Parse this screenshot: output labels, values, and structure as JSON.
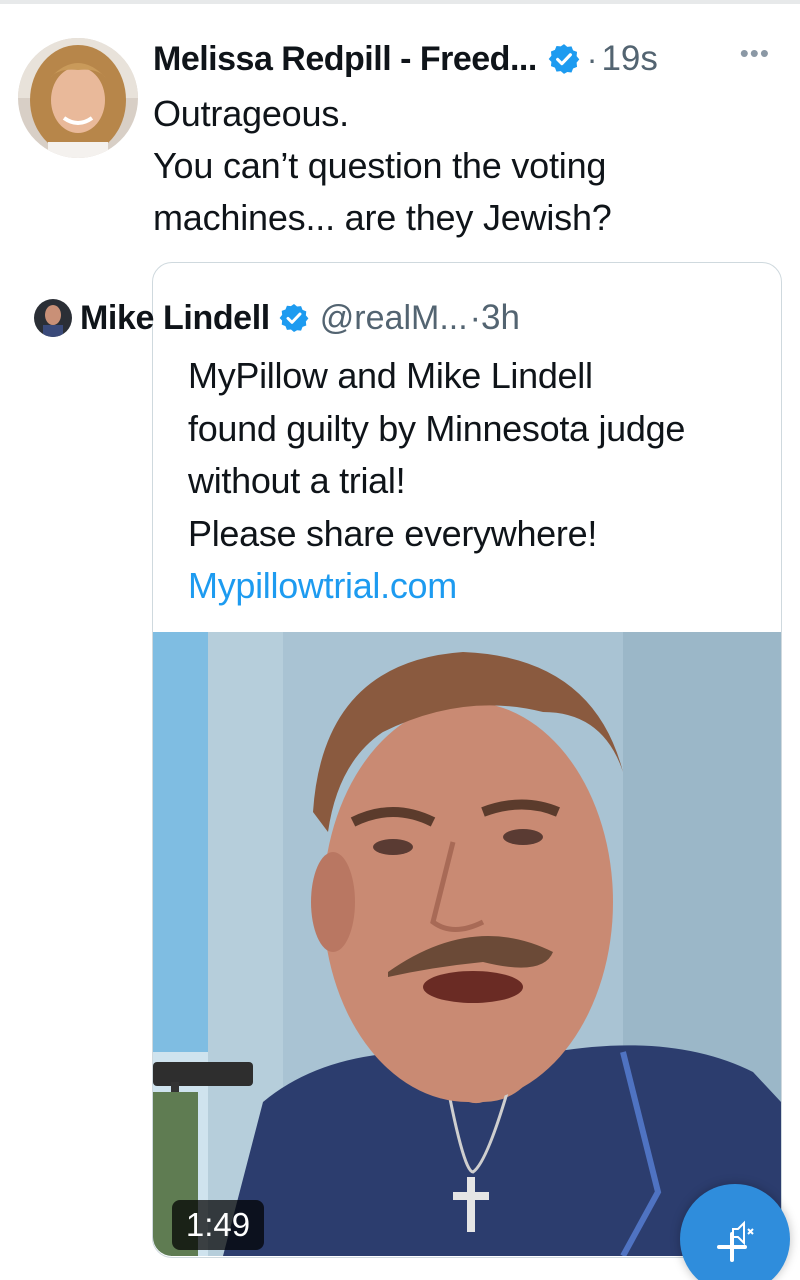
{
  "colors": {
    "accent": "#1d9bf0",
    "text_primary": "#0f1419",
    "text_secondary": "#536471",
    "border": "#cfd9de",
    "fab": "#2f8ddc"
  },
  "tweet": {
    "display_name": "Melissa Redpill - Freed...",
    "verified_icon": "verified-badge-icon",
    "separator": "·",
    "timestamp": "19s",
    "more_icon": "more-options-icon",
    "text_lines": [
      "Outrageous.",
      "You can’t question the voting",
      "machines... are they Jewish?"
    ]
  },
  "quoted_tweet": {
    "display_name": "Mike Lindell",
    "verified_icon": "verified-badge-icon",
    "handle": "@realM...",
    "separator": "·",
    "timestamp": "3h",
    "text_lines": [
      "MyPillow and Mike Lindell",
      "found guilty by Minnesota judge",
      "without a trial!",
      "Please share everywhere!"
    ],
    "link": "Mypillowtrial.com",
    "video_duration": "1:49"
  },
  "fab": {
    "icon": "compose-plus-icon",
    "overlay_icon": "mute-speaker-icon"
  }
}
